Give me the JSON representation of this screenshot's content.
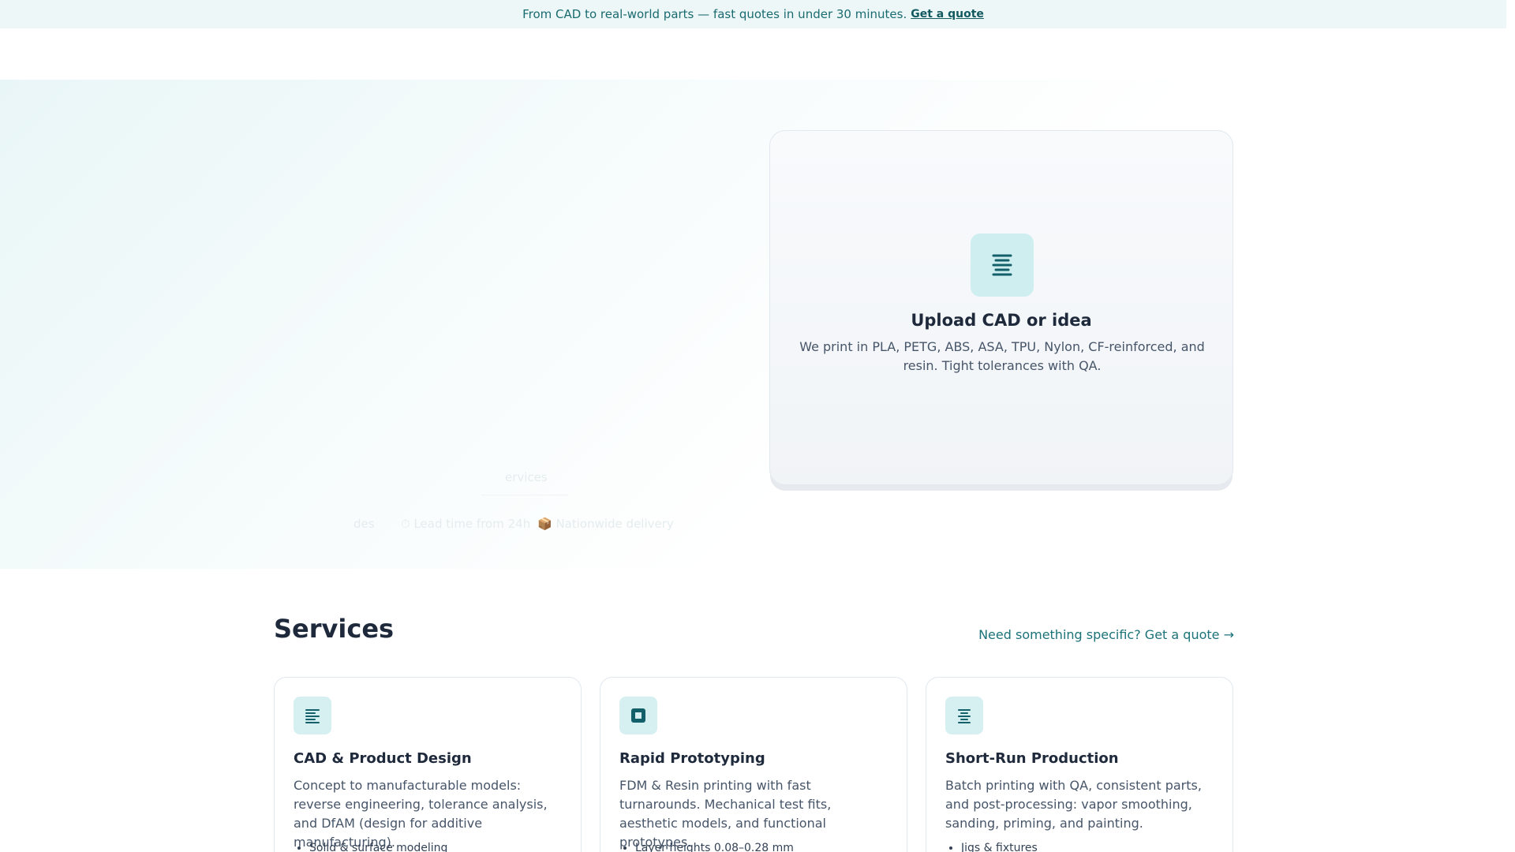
{
  "announcement": {
    "text": "From CAD to real-world parts — fast quotes in under 30 minutes.",
    "link_label": "Get a quote"
  },
  "hero": {
    "ghost_link_label": "ervices",
    "ghost_pills": [
      "des",
      "⏱ Lead time from 24h",
      "📦 Nationwide delivery"
    ]
  },
  "upload_card": {
    "icon": "document-lines-icon",
    "title": "Upload CAD or idea",
    "description": "We print in PLA, PETG, ABS, ASA, TPU, Nylon, CF-reinforced, and resin. Tight tolerances with QA."
  },
  "services": {
    "title": "Services",
    "cta_label": "Need something specific? Get a quote →",
    "cards": [
      {
        "icon": "align-left-icon",
        "title": "CAD & Product Design",
        "description": "Concept to manufacturable models: reverse engineering, tolerance analysis, and DfAM (design for additive manufacturing).",
        "first_bullet": "Solid & surface modeling"
      },
      {
        "icon": "square-icon",
        "title": "Rapid Prototyping",
        "description": "FDM & Resin printing with fast turnarounds. Mechanical test fits, aesthetic models, and functional prototypes.",
        "first_bullet": "Layer heights 0.08–0.28 mm"
      },
      {
        "icon": "align-center-icon",
        "title": "Short-Run Production",
        "description": "Batch printing with QA, consistent parts, and post-processing: vapor smoothing, sanding, priming, and painting.",
        "first_bullet": "Jigs & fixtures"
      }
    ]
  },
  "colors": {
    "accent": "#1b7379",
    "icon_bg": "#d6f0f1",
    "banner_bg": "#edf7f8"
  }
}
